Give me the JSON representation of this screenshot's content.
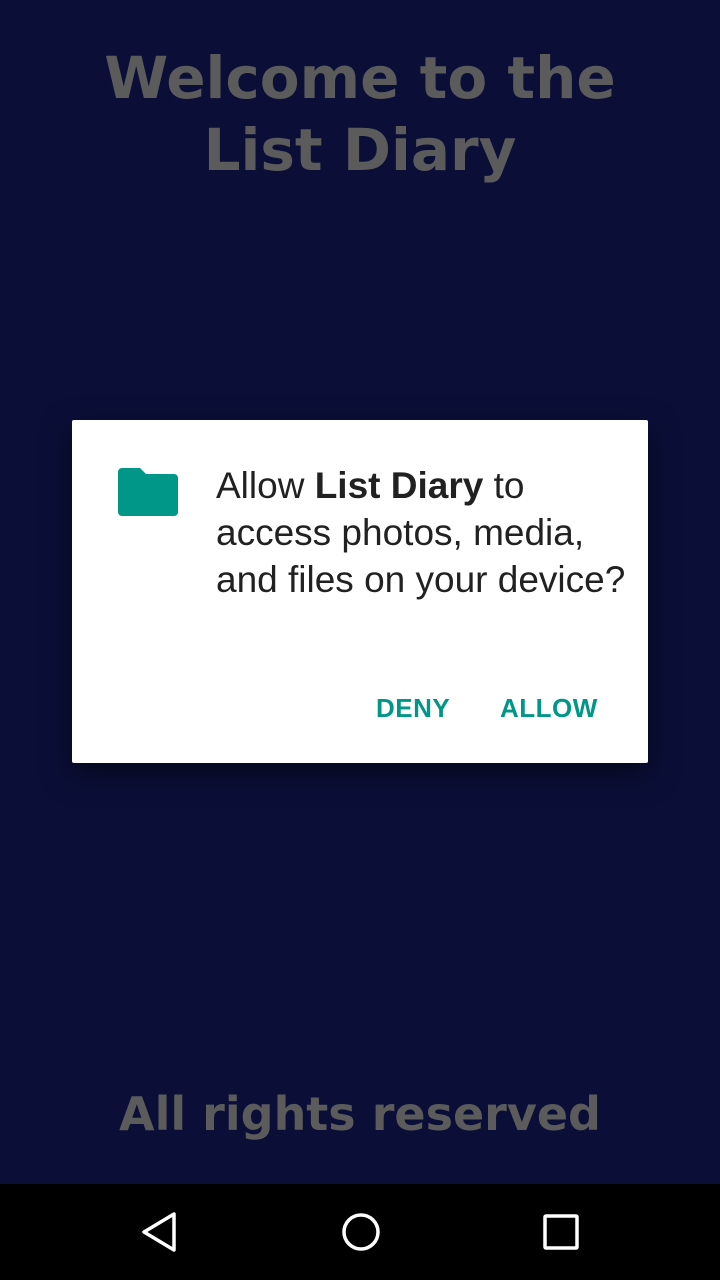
{
  "app": {
    "welcome_title": "Welcome to the List Diary",
    "footer_text": "All rights reserved"
  },
  "permission_dialog": {
    "icon": "folder-icon",
    "message_prefix": "Allow ",
    "app_name": "List Diary",
    "message_suffix": " to access photos, media, and files on your device?",
    "deny_label": "DENY",
    "allow_label": "ALLOW",
    "accent_color": "#009688"
  },
  "navigation_bar": {
    "back_icon": "back-triangle-icon",
    "home_icon": "home-circle-icon",
    "recents_icon": "recents-square-icon"
  },
  "colors": {
    "background": "#0b0f38",
    "title_text": "#5b5b5b",
    "dialog_background": "#ffffff",
    "dialog_text": "#212121"
  }
}
